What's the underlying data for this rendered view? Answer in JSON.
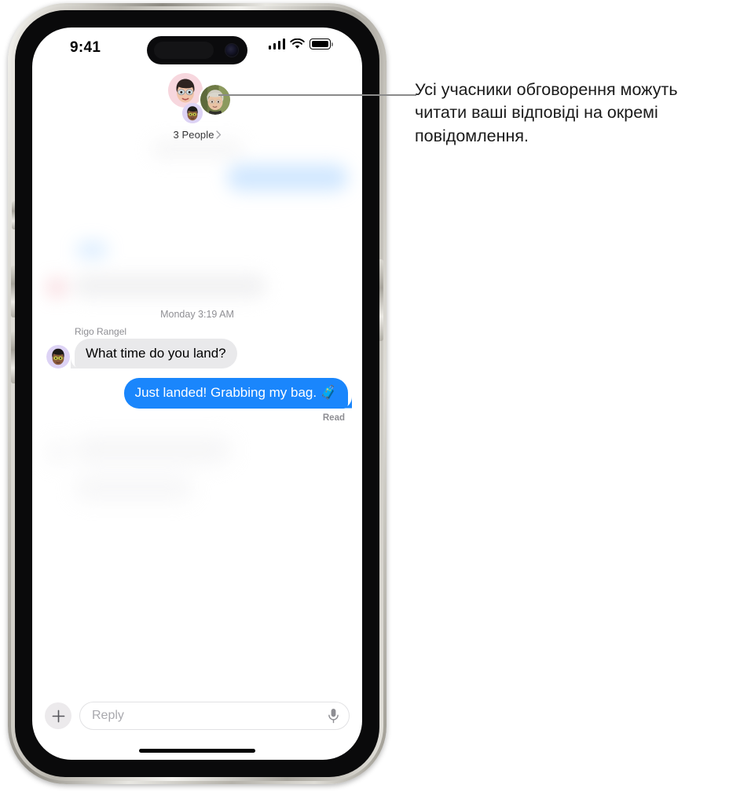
{
  "device": {
    "status_bar": {
      "time": "9:41",
      "cellular_icon": "signal-bars-icon",
      "wifi_icon": "wifi-icon",
      "battery_icon": "battery-full-icon"
    },
    "home_indicator": "home-indicator"
  },
  "conversation": {
    "participants_label": "3 People",
    "participants_chevron": "chevron-right-icon",
    "avatars": [
      {
        "name": "memoji-avatar-pink",
        "type": "memoji",
        "bg": "#f7d7de"
      },
      {
        "name": "photo-avatar",
        "type": "photo",
        "bg": "#8e9b6c"
      },
      {
        "name": "memoji-avatar-purple",
        "type": "memoji",
        "bg": "#ddd3f5"
      }
    ],
    "timestamp": "Monday 3:19 AM",
    "messages": [
      {
        "id": "msg-incoming-1",
        "direction": "incoming",
        "sender": "Rigo Rangel",
        "text": "What time do you land?",
        "avatar": "memoji-avatar-purple"
      },
      {
        "id": "msg-outgoing-1",
        "direction": "outgoing",
        "text": "Just landed! Grabbing my bag. 🧳",
        "status": "Read"
      }
    ]
  },
  "input_bar": {
    "add_button_icon": "plus-icon",
    "reply_placeholder": "Reply",
    "reply_value": "",
    "dictation_icon": "microphone-icon"
  },
  "callout": {
    "text": "Усі учасники обговорення можуть читати ваші відповіді на окремі повідомлення."
  },
  "colors": {
    "imessage_blue": "#1a86fc",
    "incoming_gray": "#e9e9eb",
    "secondary_text": "#8e8e93",
    "leader_line": "#8a8a8a"
  }
}
